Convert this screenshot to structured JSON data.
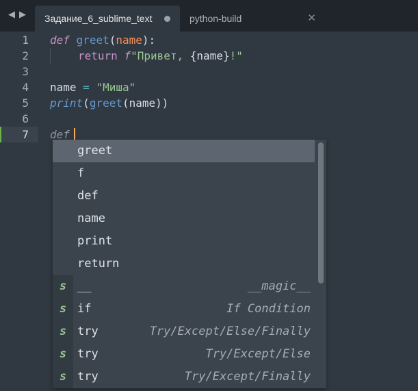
{
  "tabs": [
    {
      "label": "Задание_6_sublime_text",
      "state": "modified"
    },
    {
      "label": "python-build",
      "state": "closable"
    }
  ],
  "nav": {
    "back": "◀",
    "forward": "▶"
  },
  "lines": [
    {
      "num": "1"
    },
    {
      "num": "2"
    },
    {
      "num": "3"
    },
    {
      "num": "4"
    },
    {
      "num": "5"
    },
    {
      "num": "6"
    },
    {
      "num": "7"
    }
  ],
  "code": {
    "l1": {
      "kw": "def",
      "name": "greet",
      "open": "(",
      "param": "name",
      "close": "):"
    },
    "l2": {
      "kw": "return",
      "prefix": "f",
      "str": "\"Привет, ",
      "interp": "{name}",
      "str_end": "!\""
    },
    "l4": {
      "name": "name",
      "op": " = ",
      "str": "\"Миша\""
    },
    "l5": {
      "fn": "print",
      "open": "(",
      "call": "greet",
      "inner": "(name))"
    },
    "l7": {
      "kw": "def"
    }
  },
  "autocomplete": {
    "items": [
      {
        "kind": "",
        "label": "greet",
        "hint": ""
      },
      {
        "kind": "",
        "label": "f",
        "hint": ""
      },
      {
        "kind": "",
        "label": "def",
        "hint": ""
      },
      {
        "kind": "",
        "label": "name",
        "hint": ""
      },
      {
        "kind": "",
        "label": "print",
        "hint": ""
      },
      {
        "kind": "",
        "label": "return",
        "hint": ""
      },
      {
        "kind": "s",
        "label": "__",
        "hint": "__magic__"
      },
      {
        "kind": "s",
        "label": "if",
        "hint": "If Condition"
      },
      {
        "kind": "s",
        "label": "try",
        "hint": "Try/Except/Else/Finally"
      },
      {
        "kind": "s",
        "label": "try",
        "hint": "Try/Except/Else"
      },
      {
        "kind": "s",
        "label": "try",
        "hint": "Try/Except/Finally"
      }
    ]
  },
  "colors": {
    "background": "#303841",
    "tabbar": "#1f252b",
    "keyword": "#c594c5",
    "function": "#6699cc",
    "parameter": "#f99157",
    "string": "#99c794",
    "caret": "#f9ae58",
    "current_line_marker": "#6cb34a"
  }
}
